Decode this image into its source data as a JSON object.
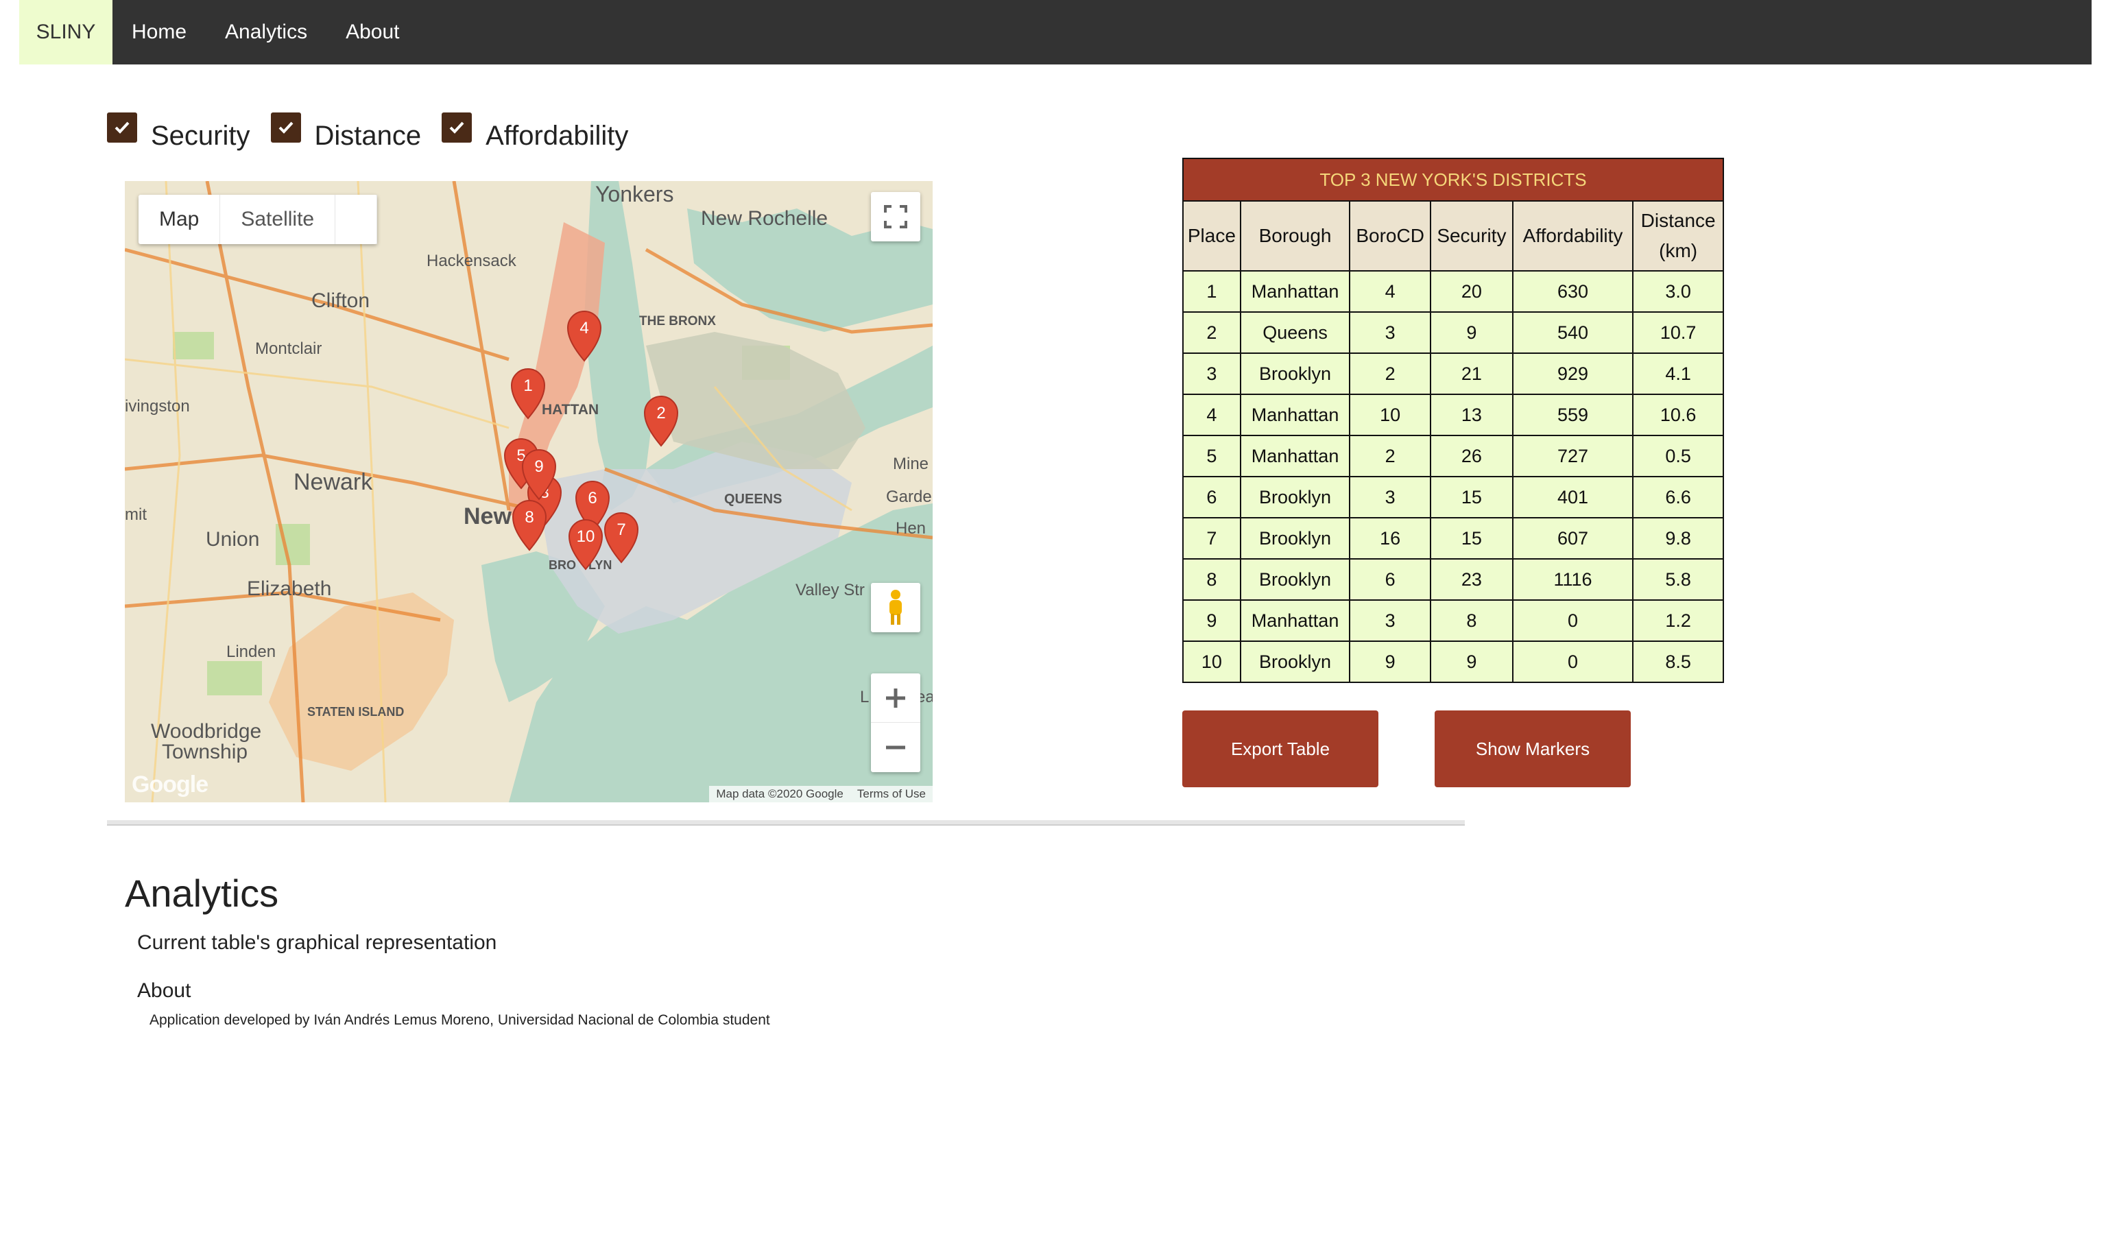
{
  "navbar": {
    "brand": "SLINY",
    "links": [
      "Home",
      "Analytics",
      "About"
    ]
  },
  "filters": [
    {
      "label": "Security",
      "checked": true
    },
    {
      "label": "Distance",
      "checked": true
    },
    {
      "label": "Affordability",
      "checked": true
    }
  ],
  "map": {
    "type_buttons": [
      "Map",
      "Satellite"
    ],
    "active_type": "Map",
    "places": [
      "Yonkers",
      "New Rochelle",
      "Hackensack",
      "Clifton",
      "Montclair",
      "ivingston",
      "THE BRONX",
      "HATTAN",
      "Mine",
      "Garde",
      "Hen",
      "Newark",
      "New",
      "QUEENS",
      "mit",
      "Union",
      "Elizabeth",
      "Valley Str",
      "Linden",
      "STATEN ISLAND",
      "Woodbridge",
      "Township",
      "L",
      "ea",
      "BRO",
      "LYN"
    ],
    "markers": [
      "1",
      "2",
      "3",
      "4",
      "5",
      "6",
      "7",
      "8",
      "9",
      "10"
    ],
    "footer_data": "Map data ©2020 Google",
    "footer_terms": "Terms of Use",
    "logo": "Google"
  },
  "table": {
    "caption": "TOP 3 NEW YORK'S DISTRICTS",
    "headers": [
      "Place",
      "Borough",
      "BoroCD",
      "Security",
      "Affordability",
      "Distance (km)"
    ],
    "rows": [
      [
        "1",
        "Manhattan",
        "4",
        "20",
        "630",
        "3.0"
      ],
      [
        "2",
        "Queens",
        "3",
        "9",
        "540",
        "10.7"
      ],
      [
        "3",
        "Brooklyn",
        "2",
        "21",
        "929",
        "4.1"
      ],
      [
        "4",
        "Manhattan",
        "10",
        "13",
        "559",
        "10.6"
      ],
      [
        "5",
        "Manhattan",
        "2",
        "26",
        "727",
        "0.5"
      ],
      [
        "6",
        "Brooklyn",
        "3",
        "15",
        "401",
        "6.6"
      ],
      [
        "7",
        "Brooklyn",
        "16",
        "15",
        "607",
        "9.8"
      ],
      [
        "8",
        "Brooklyn",
        "6",
        "23",
        "1116",
        "5.8"
      ],
      [
        "9",
        "Manhattan",
        "3",
        "8",
        "0",
        "1.2"
      ],
      [
        "10",
        "Brooklyn",
        "9",
        "9",
        "0",
        "8.5"
      ]
    ]
  },
  "buttons": {
    "export": "Export Table",
    "markers": "Show Markers"
  },
  "analytics": {
    "title": "Analytics",
    "subtitle": "Current table's graphical representation"
  },
  "about": {
    "title": "About",
    "text": "Application developed by Iván Andrés Lemus Moreno, Universidad Nacional de Colombia student"
  },
  "colors": {
    "navbar": "#333333",
    "brand_bg": "#eefcce",
    "accent": "#a33c28",
    "caption_text": "#f5d77a",
    "cell_bg": "#eefcce",
    "header_bg": "#ece3cf",
    "checkbox": "#4a2a17",
    "marker": "#e24b34"
  }
}
